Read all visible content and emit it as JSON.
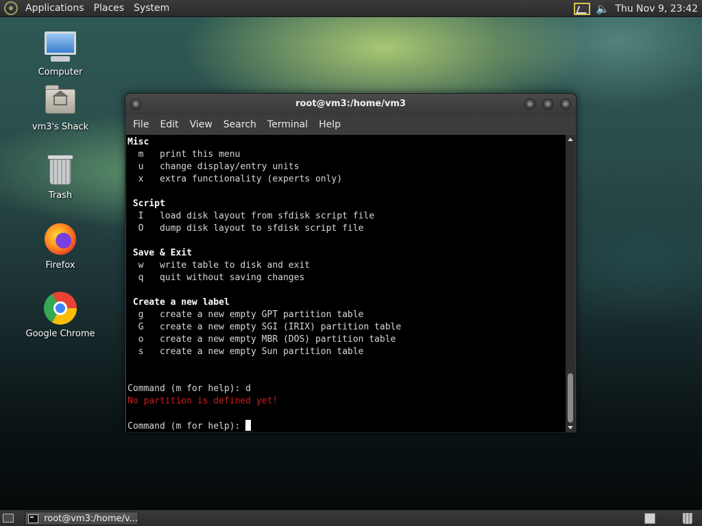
{
  "top_panel": {
    "menus": [
      "Applications",
      "Places",
      "System"
    ],
    "clock": "Thu Nov 9, 23:42",
    "tray_icons": [
      "network-icon",
      "volume-icon"
    ]
  },
  "desktop_icons": [
    {
      "label": "Computer",
      "icon": "computer-icon"
    },
    {
      "label": "vm3's Shack",
      "icon": "home-folder-icon"
    },
    {
      "label": "Trash",
      "icon": "trash-icon"
    },
    {
      "label": "Firefox",
      "icon": "firefox-icon"
    },
    {
      "label": "Google Chrome",
      "icon": "chrome-icon"
    }
  ],
  "window": {
    "title": "root@vm3:/home/vm3",
    "menus": [
      "File",
      "Edit",
      "View",
      "Search",
      "Terminal",
      "Help"
    ]
  },
  "terminal": {
    "sections": [
      {
        "heading": "Misc",
        "items": [
          {
            "key": "m",
            "desc": "print this menu"
          },
          {
            "key": "u",
            "desc": "change display/entry units"
          },
          {
            "key": "x",
            "desc": "extra functionality (experts only)"
          }
        ]
      },
      {
        "heading": "Script",
        "items": [
          {
            "key": "I",
            "desc": "load disk layout from sfdisk script file"
          },
          {
            "key": "O",
            "desc": "dump disk layout to sfdisk script file"
          }
        ]
      },
      {
        "heading": "Save & Exit",
        "items": [
          {
            "key": "w",
            "desc": "write table to disk and exit"
          },
          {
            "key": "q",
            "desc": "quit without saving changes"
          }
        ]
      },
      {
        "heading": "Create a new label",
        "items": [
          {
            "key": "g",
            "desc": "create a new empty GPT partition table"
          },
          {
            "key": "G",
            "desc": "create a new empty SGI (IRIX) partition table"
          },
          {
            "key": "o",
            "desc": "create a new empty MBR (DOS) partition table"
          },
          {
            "key": "s",
            "desc": "create a new empty Sun partition table"
          }
        ]
      }
    ],
    "prompt1": "Command (m for help): d",
    "error": "No partition is defined yet!",
    "prompt2": "Command (m for help): "
  },
  "taskbar": {
    "tasks": [
      {
        "label": "root@vm3:/home/v..."
      }
    ]
  },
  "colors": {
    "terminal_bg": "#000000",
    "terminal_fg": "#d8d8d8",
    "error": "#cc1f1f"
  }
}
